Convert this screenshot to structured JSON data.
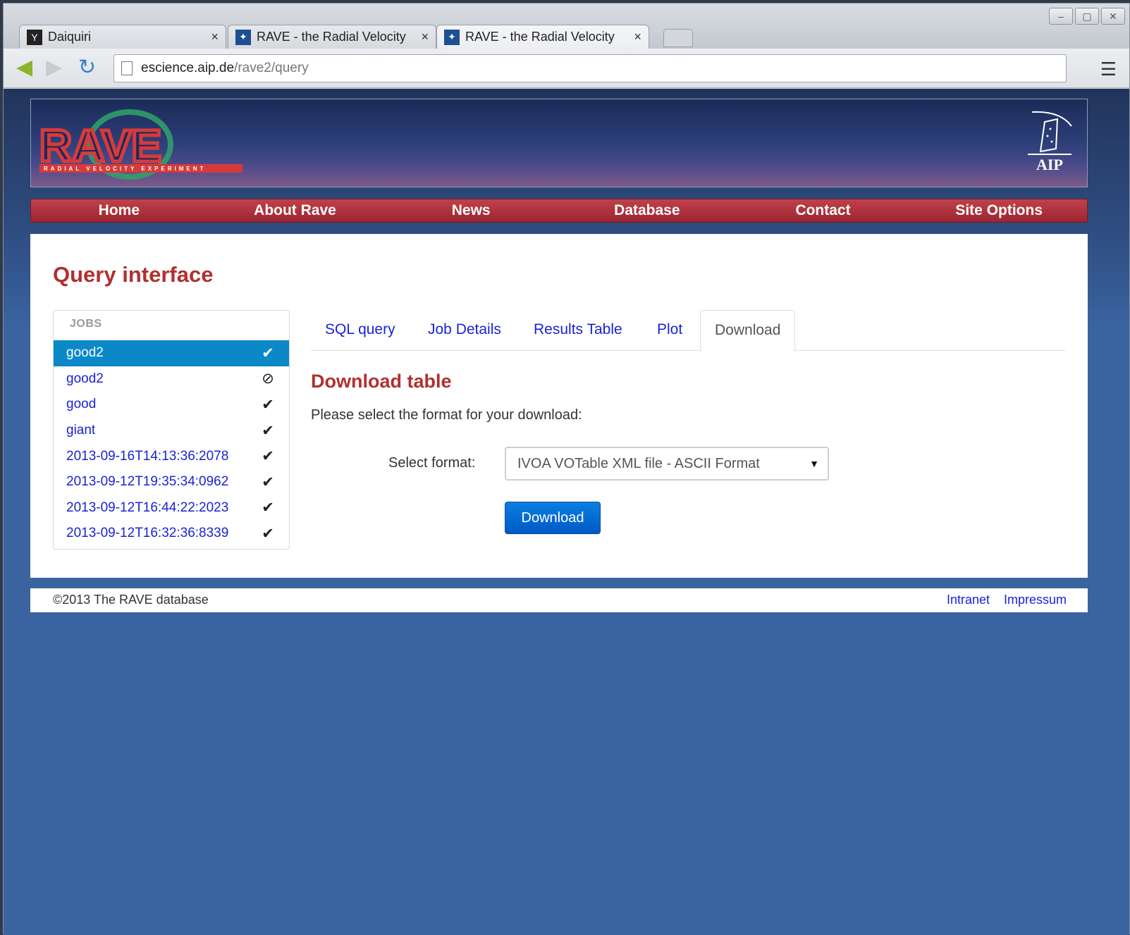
{
  "browser": {
    "tabs": [
      {
        "title": "Daiquiri",
        "favicon": "daiquiri-icon",
        "active": false
      },
      {
        "title": "RAVE - the Radial Velocity",
        "favicon": "rave-icon",
        "active": false
      },
      {
        "title": "RAVE - the Radial Velocity",
        "favicon": "rave-icon",
        "active": true
      }
    ],
    "url_host": "escience.aip.de",
    "url_path": "/rave2/query"
  },
  "brand": {
    "logo_text": "RAVE",
    "logo_subtext": "RADIAL VELOCITY EXPERIMENT",
    "partner": "AIP"
  },
  "nav": [
    "Home",
    "About Rave",
    "News",
    "Database",
    "Contact",
    "Site Options"
  ],
  "main": {
    "title": "Query interface",
    "jobs_header": "JOBS",
    "jobs": [
      {
        "name": "good2",
        "status": "✔",
        "active": true
      },
      {
        "name": "good2",
        "status": "⊘",
        "active": false
      },
      {
        "name": "good",
        "status": "✔",
        "active": false
      },
      {
        "name": "giant",
        "status": "✔",
        "active": false
      },
      {
        "name": "2013-09-16T14:13:36:2078",
        "status": "✔",
        "active": false
      },
      {
        "name": "2013-09-12T19:35:34:0962",
        "status": "✔",
        "active": false
      },
      {
        "name": "2013-09-12T16:44:22:2023",
        "status": "✔",
        "active": false
      },
      {
        "name": "2013-09-12T16:32:36:8339",
        "status": "✔",
        "active": false
      }
    ],
    "tabs": [
      "SQL query",
      "Job Details",
      "Results Table",
      "Plot",
      "Download"
    ],
    "active_tab": "Download",
    "download": {
      "title": "Download table",
      "description": "Please select the format for your download:",
      "format_label": "Select format:",
      "format_value": "IVOA VOTable XML file - ASCII Format",
      "button_label": "Download"
    }
  },
  "footer": {
    "copyright": "©2013 The RAVE database",
    "links": [
      "Intranet",
      "Impressum"
    ]
  },
  "colors": {
    "accent_red": "#b03030",
    "link_blue": "#1a23d6",
    "active_job": "#0b88c8",
    "button_blue": "#0058c7"
  }
}
